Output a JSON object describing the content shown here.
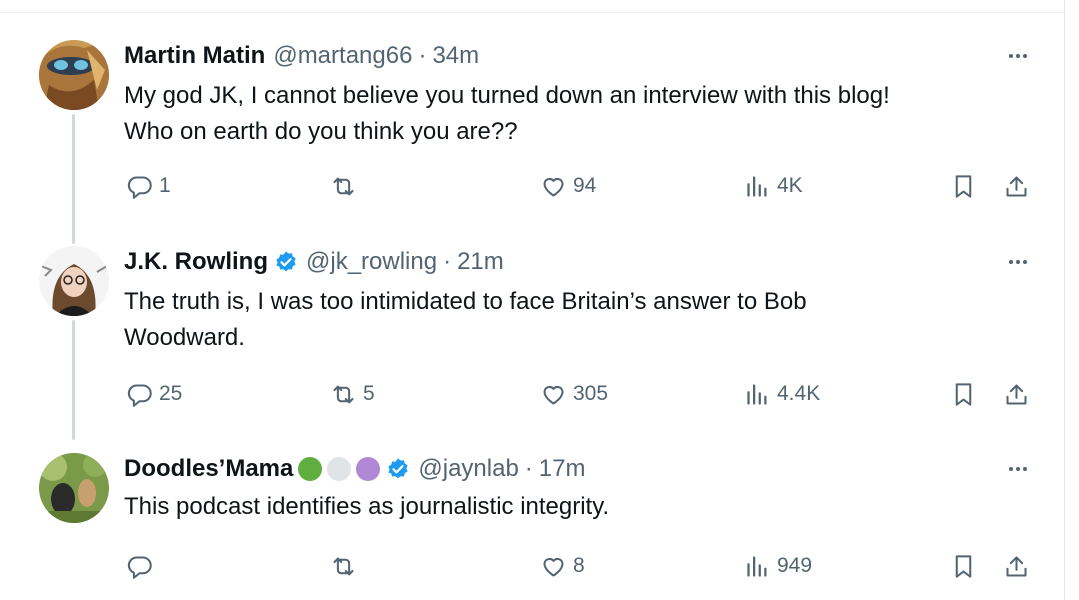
{
  "tweets": [
    {
      "name": "Martin Matin",
      "handle": "@martang66",
      "time": "34m",
      "text_lines": [
        "My god JK, I cannot believe you turned down an interview with this blog!",
        "Who on earth do you think you are??"
      ],
      "replies": "1",
      "retweets": "",
      "likes": "94",
      "views": "4K",
      "verified": false
    },
    {
      "name": "J.K. Rowling",
      "handle": "@jk_rowling",
      "time": "21m",
      "text_lines": [
        "The truth is, I was too intimidated to face Britain’s answer to Bob",
        "Woodward."
      ],
      "replies": "25",
      "retweets": "5",
      "likes": "305",
      "views": "4.4K",
      "verified": true
    },
    {
      "name": "Doodles’Mama",
      "handle": "@jaynlab",
      "time": "17m",
      "text_lines": [
        "This podcast identifies as journalistic integrity."
      ],
      "replies": "",
      "retweets": "",
      "likes": "8",
      "views": "949",
      "verified": true,
      "name_circles": [
        "#5fae3f",
        "#e1e4e6",
        "#b088d8"
      ]
    }
  ],
  "separator": "·",
  "colors": {
    "verified": "#1d9bf0",
    "secondary": "#536471",
    "thread_line": "#cfd9de"
  },
  "icons": [
    "reply-icon",
    "retweet-icon",
    "like-icon",
    "views-icon",
    "bookmark-icon",
    "share-icon",
    "more-icon",
    "verified-badge-icon"
  ]
}
